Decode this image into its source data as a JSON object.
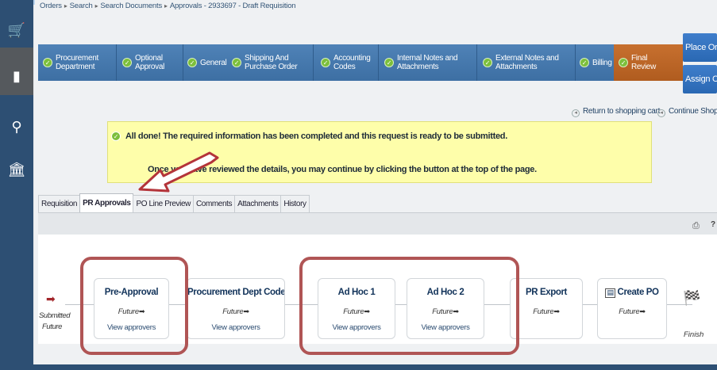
{
  "breadcrumb": [
    "Orders",
    "Search",
    "Search Documents",
    "Approvals - 2933697 - Draft Requisition"
  ],
  "sidebar": {
    "icons": [
      "shopping-cart-icon",
      "documents-icon",
      "pin-icon",
      "bank-icon"
    ]
  },
  "steps": [
    {
      "label": "Procurement Department"
    },
    {
      "label": "Optional Approval"
    },
    {
      "label": "General"
    },
    {
      "label": "Shipping And Purchase Order"
    },
    {
      "label": "Accounting Codes"
    },
    {
      "label": "Internal Notes and Attachments"
    },
    {
      "label": "External Notes and Attachments"
    },
    {
      "label": "Billing"
    },
    {
      "label": "Final Review"
    }
  ],
  "actions": {
    "place_order": "Place Order",
    "assign_cart": "Assign Cart"
  },
  "links": {
    "return_cart": "Return to shopping cart",
    "continue_shopping": "Continue Shopping"
  },
  "notice": {
    "line1": "All done! The required information has been completed and this request is ready to be submitted.",
    "line2": "Once you have reviewed the details, you may continue by clicking the button at the top of the page."
  },
  "tabs": [
    "Requisition",
    "PR Approvals",
    "PO Line Preview",
    "Comments",
    "Attachments",
    "History"
  ],
  "active_tab": "PR Approvals",
  "workflow": {
    "start": {
      "label": "Submitted",
      "status": "Future"
    },
    "stages": [
      {
        "title": "Pre-Approval",
        "status": "Future",
        "link": "View approvers"
      },
      {
        "title": "Procurement Dept Code Approva",
        "status": "Future",
        "link": "View approvers"
      },
      {
        "title": "Ad Hoc 1",
        "status": "Future",
        "link": "View approvers"
      },
      {
        "title": "Ad Hoc 2",
        "status": "Future",
        "link": "View approvers"
      },
      {
        "title": "PR Export",
        "status": "Future",
        "link": ""
      },
      {
        "title": "Create PO",
        "status": "Future",
        "link": ""
      }
    ],
    "end": {
      "label": "Finish"
    }
  },
  "colors": {
    "sidebar": "#2d4f73",
    "steps_blue": "#4677ab",
    "step_final": "#bf672a",
    "check_green": "#7cbf3b",
    "notice_bg": "#fefeaa",
    "highlight": "#b05555"
  }
}
